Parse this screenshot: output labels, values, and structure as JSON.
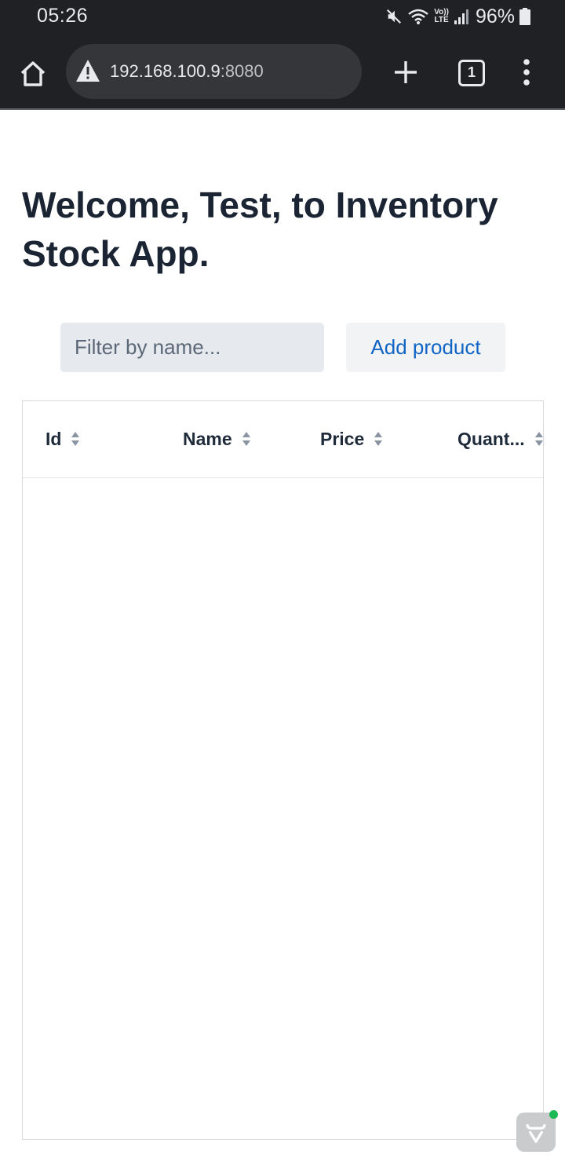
{
  "status_bar": {
    "time": "05:26",
    "battery": "96%",
    "network_label": "Vo)) LTE",
    "icons": [
      "mute-icon",
      "wifi-icon",
      "volte-icon",
      "signal-icon",
      "battery-icon"
    ]
  },
  "browser": {
    "url_host": "192.168.100.9",
    "url_port": ":8080",
    "tab_count": "1",
    "icons": [
      "home-icon",
      "warning-icon",
      "plus-icon",
      "tabs-icon",
      "more-vert-icon"
    ]
  },
  "page": {
    "title": "Welcome, Test, to Inventory Stock App.",
    "filter_placeholder": "Filter by name...",
    "filter_value": "",
    "add_button_label": "Add product"
  },
  "grid": {
    "columns": [
      {
        "label": "Id"
      },
      {
        "label": "Name"
      },
      {
        "label": "Price"
      },
      {
        "label": "Quant..."
      }
    ],
    "rows": []
  },
  "colors": {
    "browser_chrome": "#202124",
    "url_bar": "#35363a",
    "title_text": "#1a2433",
    "link_blue": "#1165c4",
    "input_bg": "#e6e9ed",
    "badge_dot": "#1db954"
  }
}
